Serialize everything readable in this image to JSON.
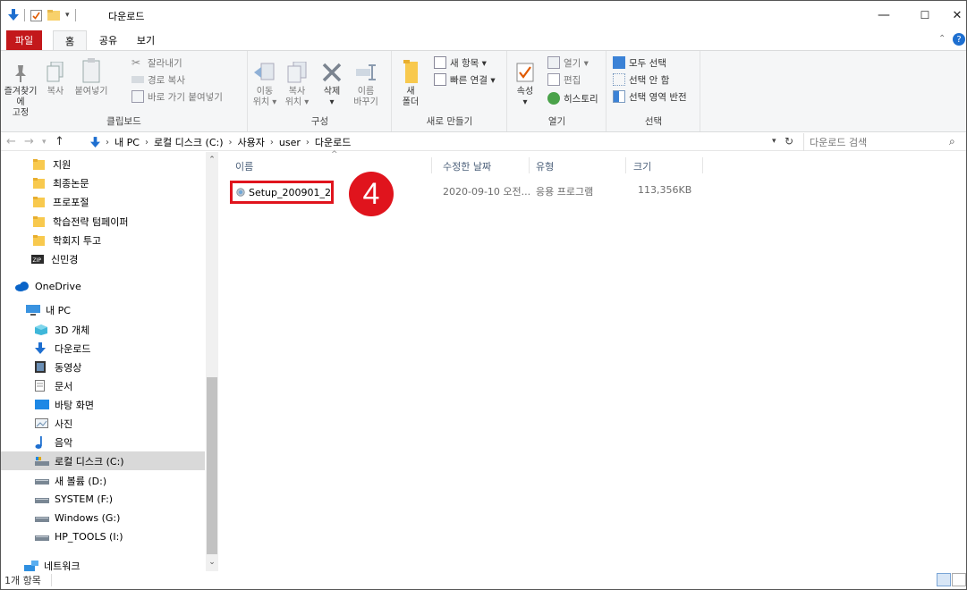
{
  "titlebar": {
    "title": "다운로드",
    "minimize": "—",
    "maximize": "☐",
    "close": "✕"
  },
  "tabs": {
    "file": "파일",
    "home": "홈",
    "share": "공유",
    "view": "보기"
  },
  "ribbon": {
    "clipboard": {
      "label": "클립보드",
      "pin": "즐겨찾기에\n고정",
      "pin_l1": "즐겨찾기에",
      "pin_l2": "고정",
      "copy": "복사",
      "paste": "붙여넣기",
      "cut": "잘라내기",
      "copy_path": "경로 복사",
      "paste_shortcut": "바로 가기 붙여넣기"
    },
    "organize": {
      "label": "구성",
      "move_l1": "이동",
      "move_l2": "위치 ▾",
      "copyto_l1": "복사",
      "copyto_l2": "위치 ▾",
      "delete_l1": "삭제",
      "delete_l2": "▾",
      "rename_l1": "이름",
      "rename_l2": "바꾸기"
    },
    "new": {
      "label": "새로 만들기",
      "folder_l1": "새",
      "folder_l2": "폴더",
      "new_item": "새 항목 ▾",
      "easy_access": "빠른 연결 ▾"
    },
    "open": {
      "label": "열기",
      "properties_l1": "속성",
      "properties_l2": "▾",
      "open": "열기 ▾",
      "edit": "편집",
      "history": "히스토리"
    },
    "select": {
      "label": "선택",
      "select_all": "모두 선택",
      "select_none": "선택 안 함",
      "invert": "선택 영역 반전"
    }
  },
  "address": {
    "crumbs": [
      "내 PC",
      "로컬 디스크 (C:)",
      "사용자",
      "user",
      "다운로드"
    ],
    "search_placeholder": "다운로드 검색"
  },
  "nav": {
    "items": [
      {
        "label": "지원",
        "icon": "folder"
      },
      {
        "label": "최종논문",
        "icon": "folder"
      },
      {
        "label": "프로포절",
        "icon": "folder"
      },
      {
        "label": "학습전략 텀페이퍼",
        "icon": "folder"
      },
      {
        "label": "학회지 투고",
        "icon": "folder"
      },
      {
        "label": "신민경",
        "icon": "zip"
      },
      {
        "label": "OneDrive",
        "icon": "cloud"
      },
      {
        "label": "내 PC",
        "icon": "pc"
      },
      {
        "label": "3D 개체",
        "icon": "3d"
      },
      {
        "label": "다운로드",
        "icon": "download"
      },
      {
        "label": "동영상",
        "icon": "video"
      },
      {
        "label": "문서",
        "icon": "document"
      },
      {
        "label": "바탕 화면",
        "icon": "desktop"
      },
      {
        "label": "사진",
        "icon": "picture"
      },
      {
        "label": "음악",
        "icon": "music"
      },
      {
        "label": "로컬 디스크 (C:)",
        "icon": "drive-c"
      },
      {
        "label": "새 볼륨 (D:)",
        "icon": "drive"
      },
      {
        "label": "SYSTEM  (F:)",
        "icon": "drive"
      },
      {
        "label": "Windows  (G:)",
        "icon": "drive"
      },
      {
        "label": "HP_TOOLS (I:)",
        "icon": "drive"
      },
      {
        "label": "네트워크",
        "icon": "network"
      }
    ]
  },
  "columns": {
    "name": "이름",
    "modified": "수정한 날짜",
    "type": "유형",
    "size": "크기"
  },
  "files": [
    {
      "name": "Setup_200901_2",
      "modified": "2020-09-10 오전...",
      "type": "응용 프로그램",
      "size": "113,356KB"
    }
  ],
  "annotation": {
    "step": "4",
    "color": "#e0141d"
  },
  "status": {
    "count": "1개 항목"
  }
}
